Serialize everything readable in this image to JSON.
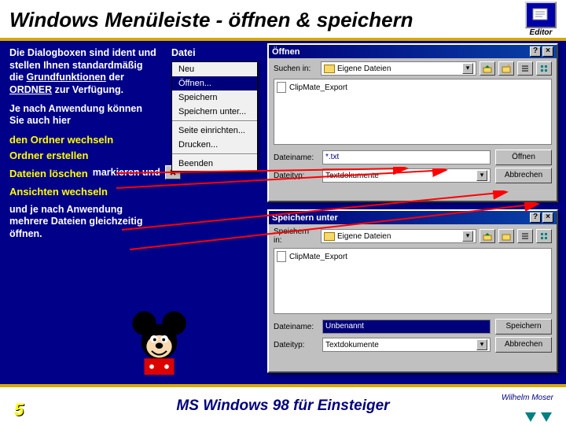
{
  "title": "Windows Menüleiste - öffnen & speichern",
  "editor_label": "Editor",
  "text": {
    "p1a": "Die Dialogboxen sind ident und stellen Ihnen standardmäßig die ",
    "p1b": "Grundfunktionen",
    "p1c": " der ",
    "p1d": "ORDNER",
    "p1e": " zur Verfügung.",
    "p2": "Je nach Anwendung können Sie auch hier",
    "a1": "den Ordner wechseln",
    "a2": "Ordner erstellen",
    "a3": "Dateien löschen",
    "a3b": "markieren und",
    "a4": "Ansichten wechseln",
    "p3": "und je nach Anwendung mehrere Dateien gleichzeitig öffnen."
  },
  "menu_label": "Datei",
  "menu": {
    "items": [
      "Neu",
      "Öffnen...",
      "Speichern",
      "Speichern unter...",
      "Seite einrichten...",
      "Drucken...",
      "Beenden"
    ]
  },
  "open_dialog": {
    "title": "Öffnen",
    "look_in": "Suchen in:",
    "folder": "Eigene Dateien",
    "file_item": "ClipMate_Export",
    "name_label": "Dateiname:",
    "name_value": "*.txt",
    "type_label": "Dateityp:",
    "type_value": "Textdokumente",
    "btn_open": "Öffnen",
    "btn_cancel": "Abbrechen"
  },
  "save_dialog": {
    "title": "Speichern unter",
    "look_in": "Speichern in:",
    "folder": "Eigene Dateien",
    "file_item": "ClipMate_Export",
    "name_label": "Dateiname:",
    "name_value": "Unbenannt",
    "type_label": "Dateityp:",
    "type_value": "Textdokumente",
    "btn_save": "Speichern",
    "btn_cancel": "Abbrechen"
  },
  "footer": {
    "page": "5",
    "center": "MS Windows 98 für Einsteiger",
    "author": "Wilhelm Moser"
  }
}
